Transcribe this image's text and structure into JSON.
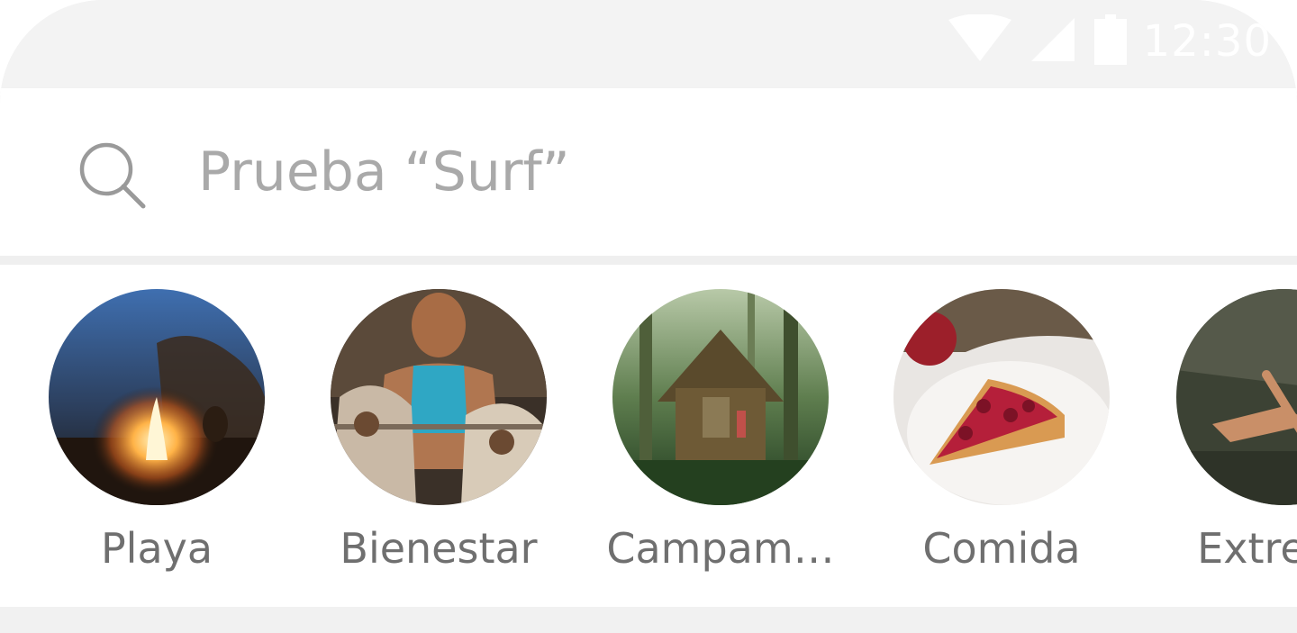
{
  "status_bar": {
    "time": "12:30",
    "icons": [
      "wifi-icon",
      "cellular-signal-icon",
      "battery-icon"
    ],
    "icon_color": "#ffffff"
  },
  "search": {
    "placeholder": "Prueba “Surf”",
    "value": "",
    "icon": "search-icon",
    "placeholder_color": "#a9a9a9"
  },
  "categories": [
    {
      "label": "Playa",
      "image": "campfire-night-photo"
    },
    {
      "label": "Bienestar",
      "image": "man-with-huskies-photo"
    },
    {
      "label": "Campam…",
      "image": "treehouse-forest-photo"
    },
    {
      "label": "Comida",
      "image": "cherry-pie-slice-photo"
    },
    {
      "label": "Extreme",
      "image": "climber-photo"
    }
  ],
  "colors": {
    "background": "#f3f3f3",
    "card": "#ffffff",
    "label_text": "#6f6f6f"
  }
}
